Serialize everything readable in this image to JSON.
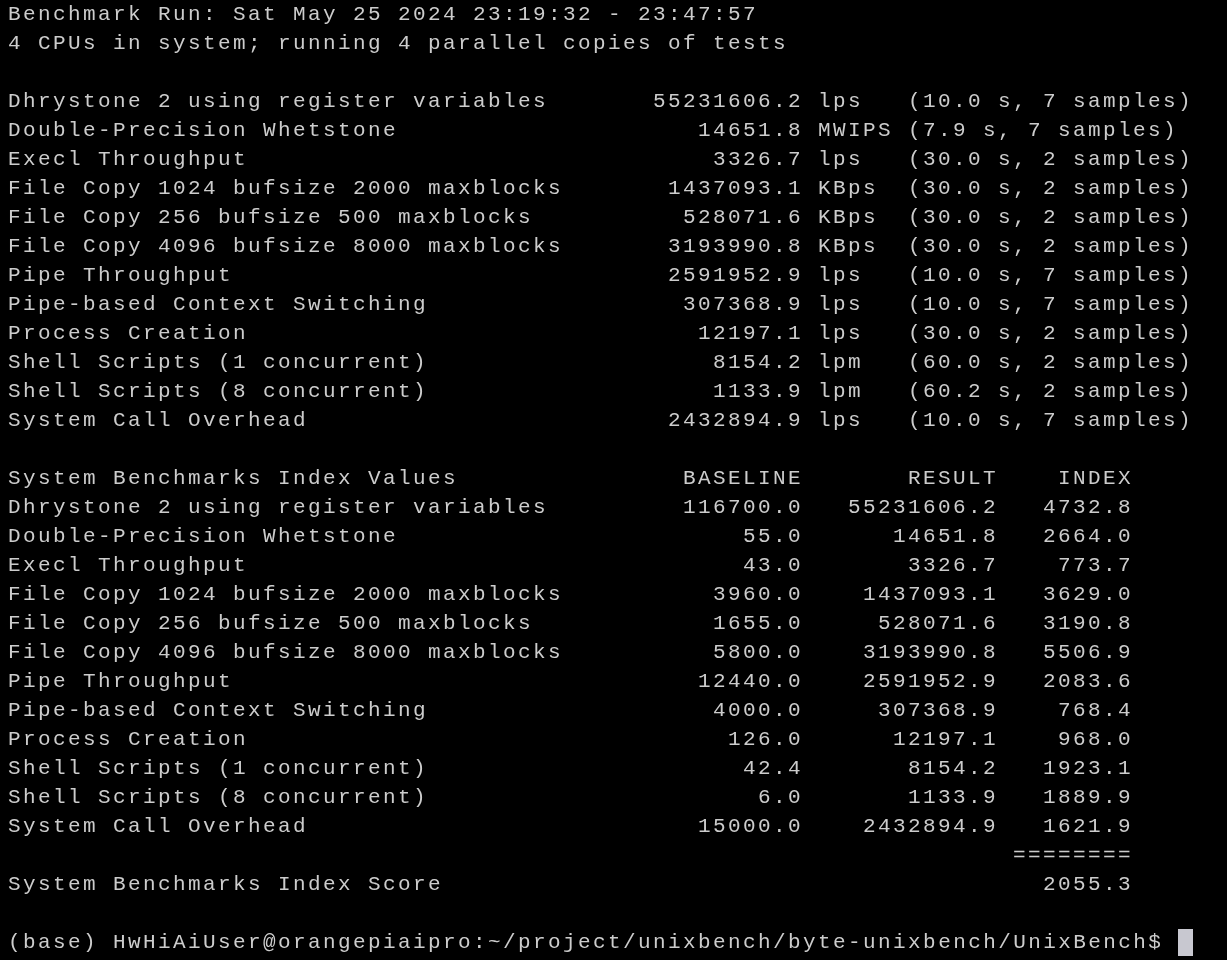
{
  "header_lines": [
    "Benchmark Run: Sat May 25 2024 23:19:32 - 23:47:57",
    "4 CPUs in system; running 4 parallel copies of tests"
  ],
  "results": [
    {
      "test": "Dhrystone 2 using register variables",
      "value": "55231606.2",
      "unit": "lps",
      "timing": "(10.0 s, 7 samples)"
    },
    {
      "test": "Double-Precision Whetstone",
      "value": "14651.8",
      "unit": "MWIPS",
      "timing": "(7.9 s, 7 samples)"
    },
    {
      "test": "Execl Throughput",
      "value": "3326.7",
      "unit": "lps",
      "timing": "(30.0 s, 2 samples)"
    },
    {
      "test": "File Copy 1024 bufsize 2000 maxblocks",
      "value": "1437093.1",
      "unit": "KBps",
      "timing": "(30.0 s, 2 samples)"
    },
    {
      "test": "File Copy 256 bufsize 500 maxblocks",
      "value": "528071.6",
      "unit": "KBps",
      "timing": "(30.0 s, 2 samples)"
    },
    {
      "test": "File Copy 4096 bufsize 8000 maxblocks",
      "value": "3193990.8",
      "unit": "KBps",
      "timing": "(30.0 s, 2 samples)"
    },
    {
      "test": "Pipe Throughput",
      "value": "2591952.9",
      "unit": "lps",
      "timing": "(10.0 s, 7 samples)"
    },
    {
      "test": "Pipe-based Context Switching",
      "value": "307368.9",
      "unit": "lps",
      "timing": "(10.0 s, 7 samples)"
    },
    {
      "test": "Process Creation",
      "value": "12197.1",
      "unit": "lps",
      "timing": "(30.0 s, 2 samples)"
    },
    {
      "test": "Shell Scripts (1 concurrent)",
      "value": "8154.2",
      "unit": "lpm",
      "timing": "(60.0 s, 2 samples)"
    },
    {
      "test": "Shell Scripts (8 concurrent)",
      "value": "1133.9",
      "unit": "lpm",
      "timing": "(60.2 s, 2 samples)"
    },
    {
      "test": "System Call Overhead",
      "value": "2432894.9",
      "unit": "lps",
      "timing": "(10.0 s, 7 samples)"
    }
  ],
  "index_table": {
    "title": "System Benchmarks Index Values",
    "columns": [
      "BASELINE",
      "RESULT",
      "INDEX"
    ],
    "rows": [
      {
        "test": "Dhrystone 2 using register variables",
        "baseline": "116700.0",
        "result": "55231606.2",
        "index": "4732.8"
      },
      {
        "test": "Double-Precision Whetstone",
        "baseline": "55.0",
        "result": "14651.8",
        "index": "2664.0"
      },
      {
        "test": "Execl Throughput",
        "baseline": "43.0",
        "result": "3326.7",
        "index": "773.7"
      },
      {
        "test": "File Copy 1024 bufsize 2000 maxblocks",
        "baseline": "3960.0",
        "result": "1437093.1",
        "index": "3629.0"
      },
      {
        "test": "File Copy 256 bufsize 500 maxblocks",
        "baseline": "1655.0",
        "result": "528071.6",
        "index": "3190.8"
      },
      {
        "test": "File Copy 4096 bufsize 8000 maxblocks",
        "baseline": "5800.0",
        "result": "3193990.8",
        "index": "5506.9"
      },
      {
        "test": "Pipe Throughput",
        "baseline": "12440.0",
        "result": "2591952.9",
        "index": "2083.6"
      },
      {
        "test": "Pipe-based Context Switching",
        "baseline": "4000.0",
        "result": "307368.9",
        "index": "768.4"
      },
      {
        "test": "Process Creation",
        "baseline": "126.0",
        "result": "12197.1",
        "index": "968.0"
      },
      {
        "test": "Shell Scripts (1 concurrent)",
        "baseline": "42.4",
        "result": "8154.2",
        "index": "1923.1"
      },
      {
        "test": "Shell Scripts (8 concurrent)",
        "baseline": "6.0",
        "result": "1133.9",
        "index": "1889.9"
      },
      {
        "test": "System Call Overhead",
        "baseline": "15000.0",
        "result": "2432894.9",
        "index": "1621.9"
      }
    ],
    "separator": "========",
    "score_label": "System Benchmarks Index Score",
    "score": "2055.3"
  },
  "prompt": "(base) HwHiAiUser@orangepiaipro:~/project/unixbench/byte-unixbench/UnixBench$"
}
